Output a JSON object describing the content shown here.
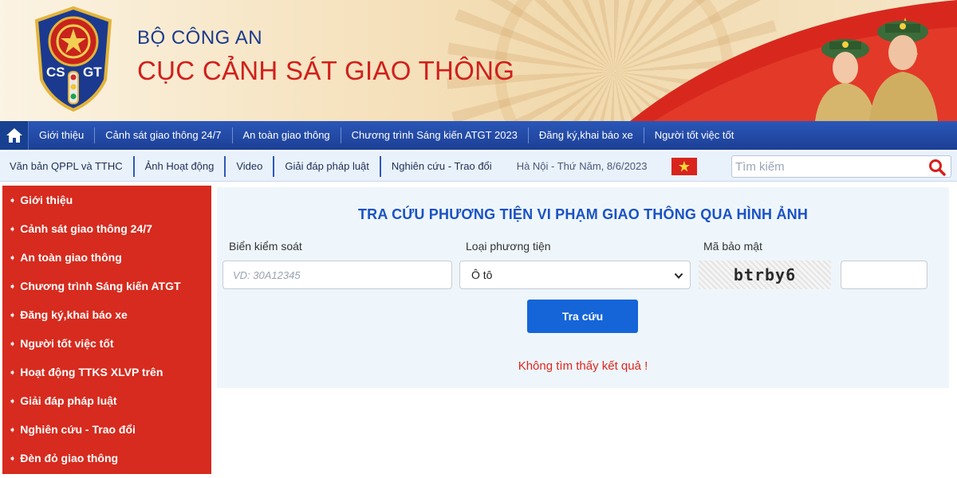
{
  "header": {
    "ministry": "BỘ CÔNG AN",
    "department": "CỤC CẢNH SÁT GIAO THÔNG",
    "emblem_text": "CSGT",
    "colors": {
      "ministry": "#1c3a8c",
      "department": "#d0201c"
    }
  },
  "nav_main": {
    "home_icon": "home-icon",
    "items": [
      {
        "label": "Giới thiệu"
      },
      {
        "label": "Cảnh sát giao thông 24/7"
      },
      {
        "label": "An toàn giao thông"
      },
      {
        "label": "Chương trình Sáng kiến ATGT 2023"
      },
      {
        "label": "Đăng ký,khai báo xe"
      },
      {
        "label": "Người tốt việc tốt"
      }
    ]
  },
  "nav_sub": {
    "items": [
      {
        "label": "Văn bản QPPL và TTHC"
      },
      {
        "label": "Ảnh Hoạt động"
      },
      {
        "label": "Video"
      },
      {
        "label": "Giải đáp pháp luật"
      },
      {
        "label": "Nghiên cứu - Trao đổi"
      }
    ],
    "date": "Hà Nội - Thứ Năm, 8/6/2023",
    "search_placeholder": "Tìm kiếm",
    "search_icon": "search-icon"
  },
  "sidebar": {
    "items": [
      {
        "label": "Giới thiệu"
      },
      {
        "label": "Cảnh sát giao thông 24/7"
      },
      {
        "label": "An toàn giao thông"
      },
      {
        "label": "Chương trình Sáng kiến ATGT"
      },
      {
        "label": "Đăng ký,khai báo xe"
      },
      {
        "label": "Người tốt việc tốt"
      },
      {
        "label": "Hoạt động TTKS XLVP trên"
      },
      {
        "label": "Giải đáp pháp luật"
      },
      {
        "label": "Nghiên cứu - Trao đổi"
      },
      {
        "label": "Đèn đỏ giao thông"
      }
    ],
    "color": "#d62b1e"
  },
  "lookup": {
    "title": "TRA CỨU PHƯƠNG TIỆN VI PHẠM GIAO THÔNG QUA HÌNH ẢNH",
    "plate_label": "Biển kiểm soát",
    "plate_placeholder": "VD: 30A12345",
    "plate_value": "",
    "vehicle_label": "Loại phương tiện",
    "vehicle_selected": "Ô tô",
    "captcha_label": "Mã bảo mật",
    "captcha_text": "btrby6",
    "captcha_input_value": "",
    "submit_label": "Tra cứu",
    "result_message": "Không tìm thấy kết quả !",
    "colors": {
      "title": "#1a52c4",
      "button": "#1565d8",
      "error": "#e0261d"
    }
  }
}
